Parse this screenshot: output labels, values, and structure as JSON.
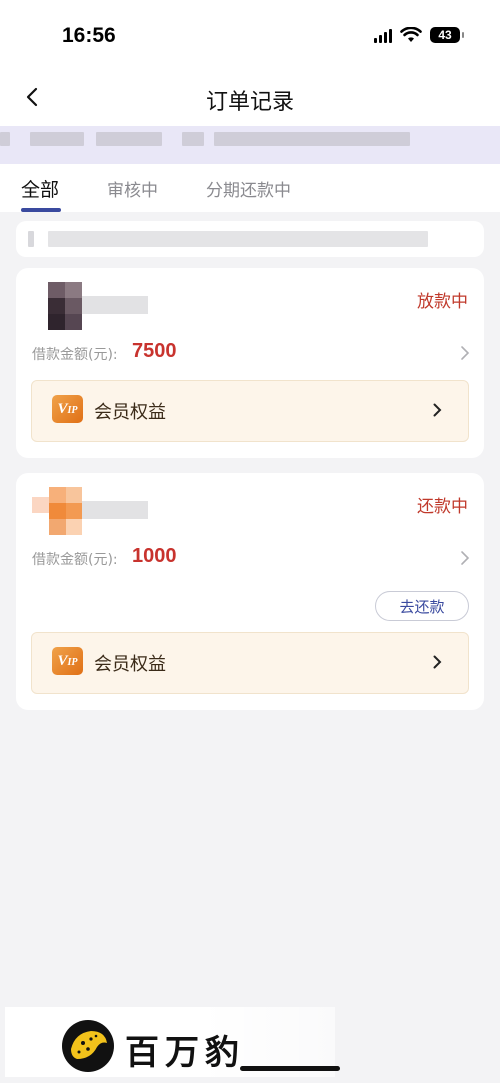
{
  "status_bar": {
    "time": "16:56",
    "battery": "43"
  },
  "nav": {
    "title": "订单记录"
  },
  "tabs": [
    {
      "label": "全部",
      "active": true
    },
    {
      "label": "审核中",
      "active": false
    },
    {
      "label": "分期还款中",
      "active": false
    }
  ],
  "orders": [
    {
      "status": "放款中",
      "amount_label": "借款金额(元):",
      "amount": "7500",
      "vip_label": "会员权益"
    },
    {
      "status": "还款中",
      "amount_label": "借款金额(元):",
      "amount": "1000",
      "repay_label": "去还款",
      "vip_label": "会员权益"
    }
  ],
  "watermark": {
    "text": "百万豹"
  },
  "colors": {
    "accent": "#3a4a9f",
    "status_red": "#c0392b",
    "amount_red": "#c8332e",
    "vip_bg": "#fdf5ea",
    "page_bg": "#f3f3f5"
  },
  "icons": [
    "back-icon",
    "signal-icon",
    "wifi-icon",
    "battery-icon",
    "chevron-right-icon",
    "vip-icon",
    "leopard-logo-icon"
  ]
}
